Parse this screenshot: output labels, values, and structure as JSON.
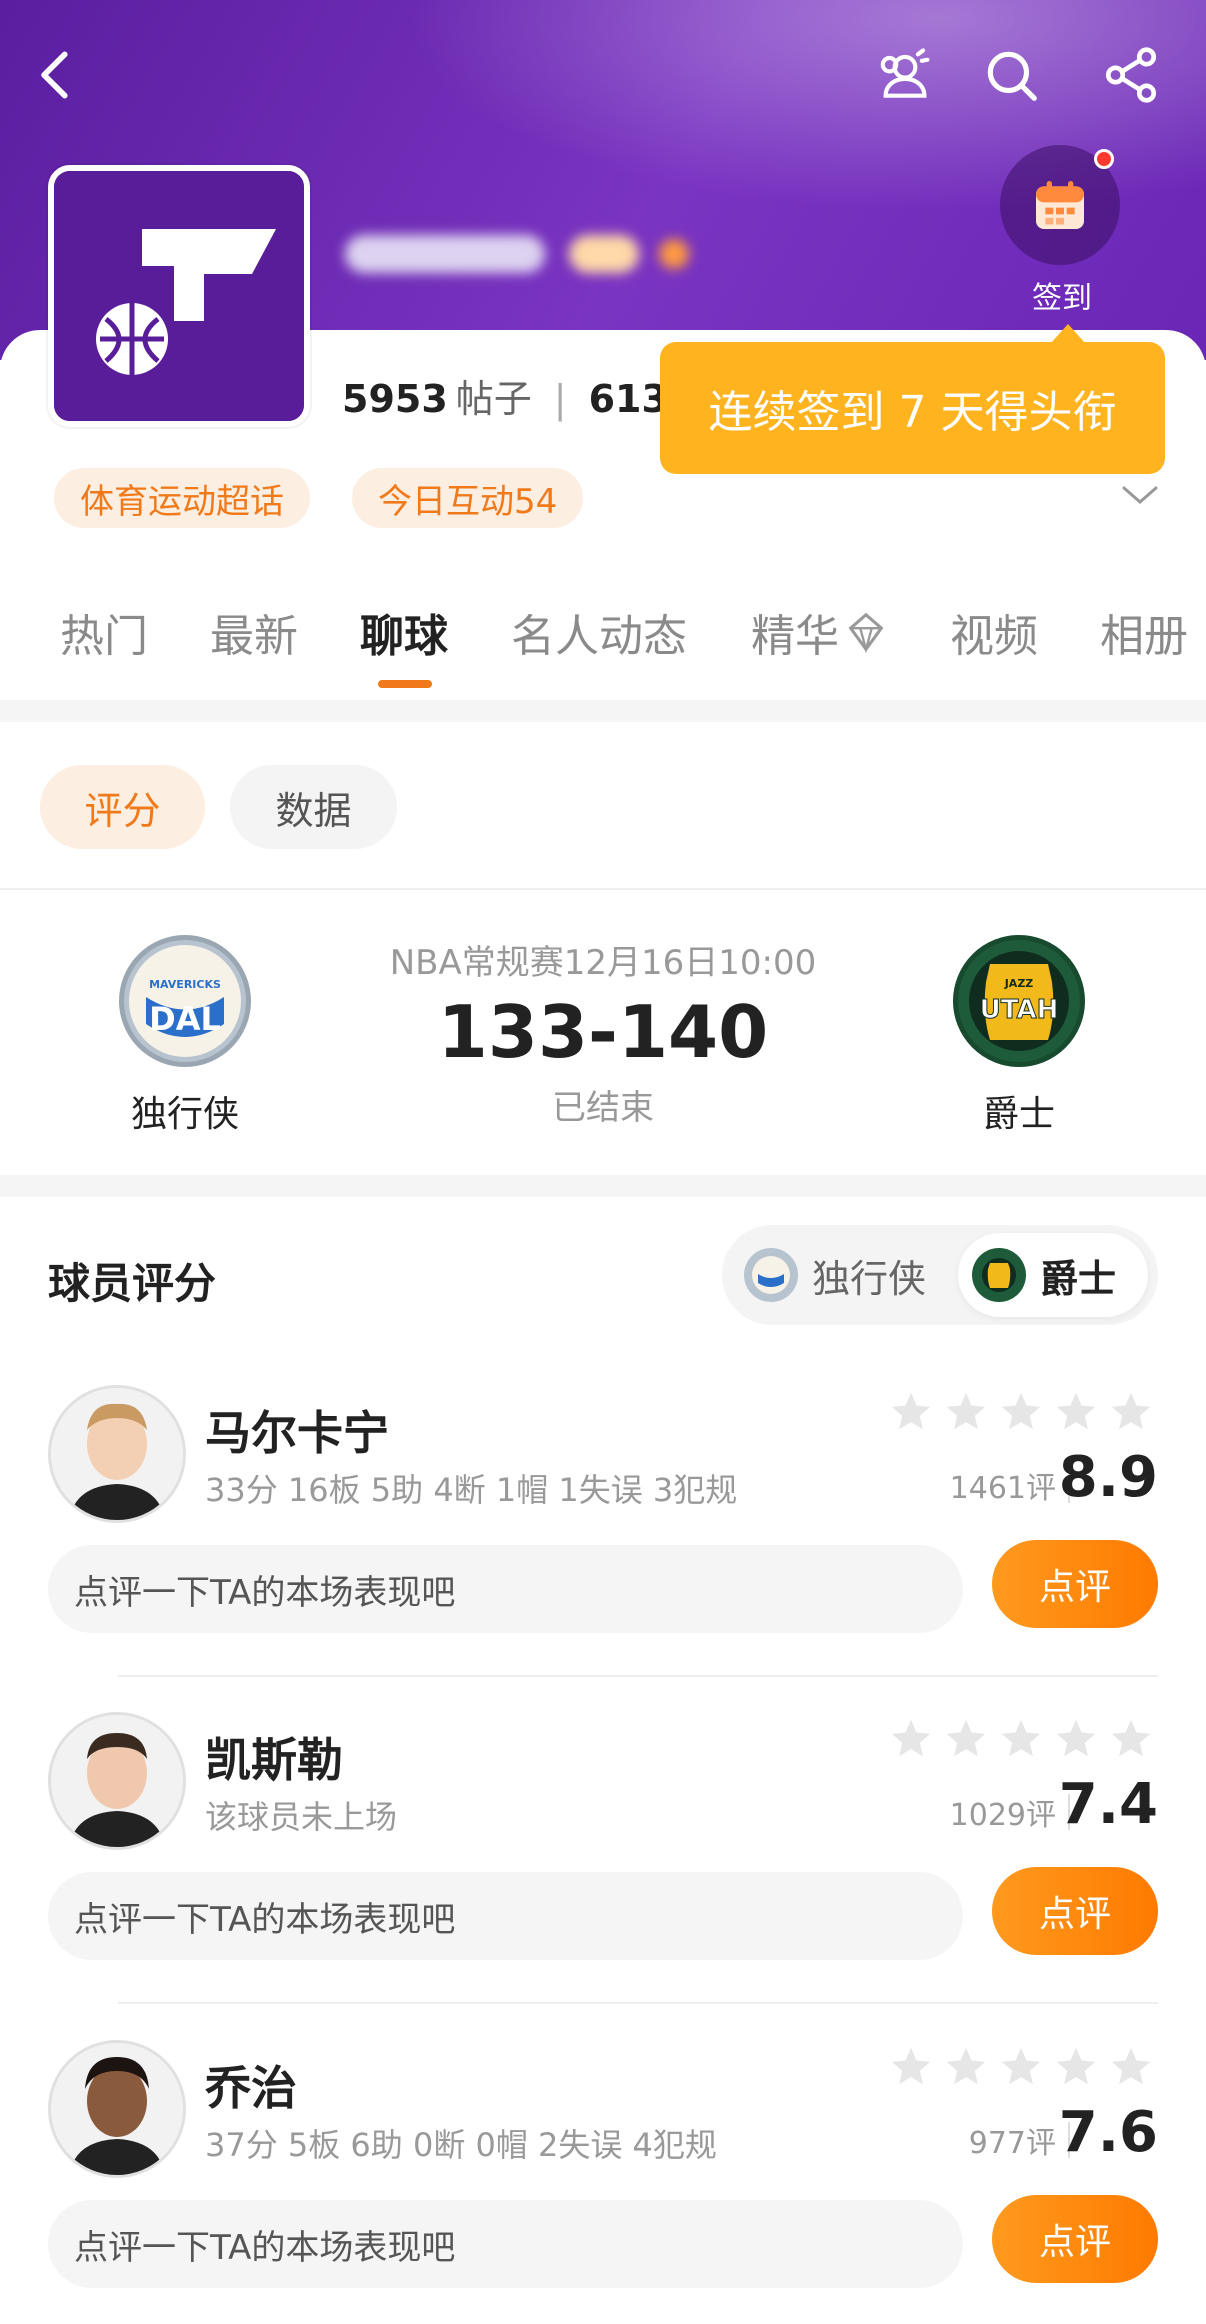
{
  "header": {
    "checkin_label": "签到",
    "tooltip": "连续签到 7 天得头衔",
    "stats": {
      "posts_count": "5953",
      "posts_unit": "帖子",
      "second_count": "6138"
    },
    "tags": [
      "体育运动超话",
      "今日互动54"
    ]
  },
  "tabs": [
    "热门",
    "最新",
    "聊球",
    "名人动态",
    "精华",
    "视频",
    "相册"
  ],
  "active_tab": "聊球",
  "sub_tabs": {
    "rating": "评分",
    "data": "数据"
  },
  "match": {
    "info": "NBA常规赛12月16日10:00",
    "score": "133-140",
    "status": "已结束",
    "home": {
      "name": "独行侠",
      "logo_line1": "MAVERICKS",
      "logo_line2": "DAL"
    },
    "away": {
      "name": "爵士",
      "logo_line1": "JAZZ",
      "logo_line2": "UTAH"
    }
  },
  "player_ratings": {
    "title": "球员评分",
    "switch": {
      "left": "独行侠",
      "right": "爵士"
    },
    "comment_placeholder": "点评一下TA的本场表现吧",
    "comment_button": "点评",
    "players": [
      {
        "name": "马尔卡宁",
        "stats": "33分 16板 5助 4断 1帽 1失误 3犯规",
        "count": "1461评",
        "rating": "8.9"
      },
      {
        "name": "凯斯勒",
        "stats": "该球员未上场",
        "count": "1029评",
        "rating": "7.4"
      },
      {
        "name": "乔治",
        "stats": "37分 5板 6助 0断 0帽 2失误 4犯规",
        "count": "977评",
        "rating": "7.6"
      }
    ]
  },
  "colors": {
    "accent": "#f07a1a",
    "header_purple": "#6a26b5",
    "tooltip": "#ffb31f",
    "jazz_green": "#1e5b3a",
    "mavs_blue": "#2a6fc9"
  }
}
